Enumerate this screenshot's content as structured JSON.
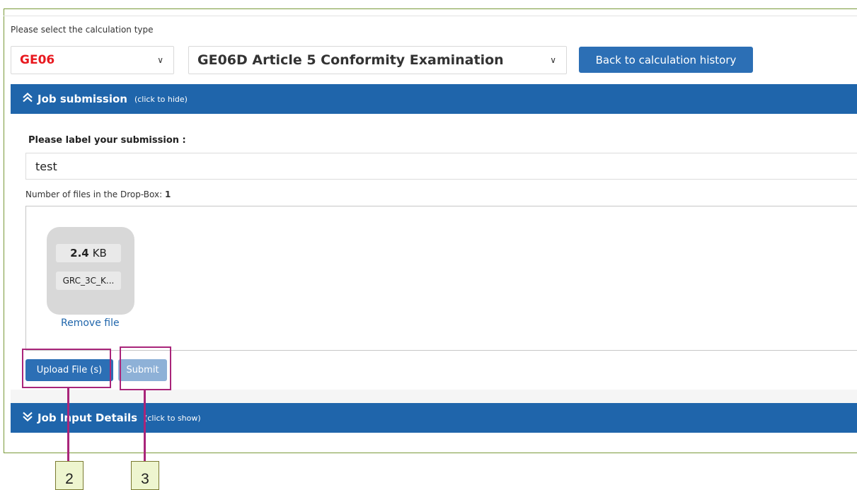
{
  "calc": {
    "label": "Please select the calculation type",
    "type_value": "GE06",
    "subtype_value": "GE06D Article 5 Conformity Examination",
    "back_button": "Back to calculation history"
  },
  "job_submission": {
    "title": "Job submission",
    "hint": "(click to hide)",
    "label_prompt": "Please label your submission :",
    "label_value": "test",
    "files_count_label": "Number of files in the Drop-Box:",
    "files_count": "1",
    "file": {
      "size_value": "2.4",
      "size_unit": "KB",
      "name": "GRC_3C_K..."
    },
    "remove_link": "Remove file",
    "upload_button": "Upload File (s)",
    "submit_button": "Submit"
  },
  "job_input": {
    "title": "Job Input Details",
    "hint": "(click to show)"
  },
  "callouts": {
    "upload": "2",
    "submit": "3"
  },
  "colors": {
    "primary_blue": "#1f65ab",
    "button_blue": "#2c6fb5",
    "disabled_blue": "#8eb1d7",
    "type_red": "#e8191f",
    "annotation_magenta": "#a9257a"
  },
  "icons": {
    "select_chevron": "chevron-down-icon",
    "collapse": "double-chevron-up-icon",
    "expand": "double-chevron-down-icon"
  }
}
